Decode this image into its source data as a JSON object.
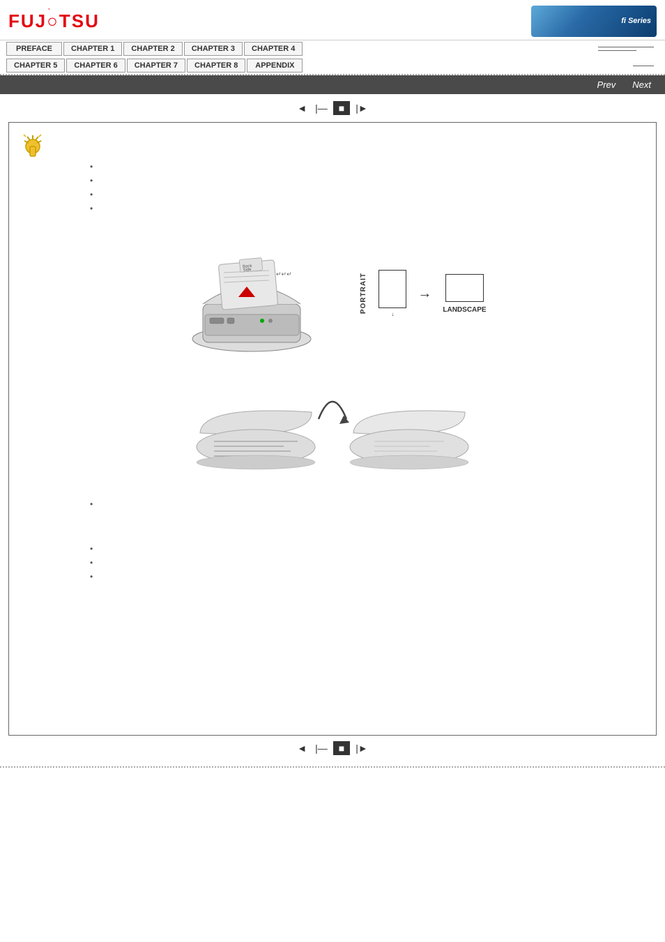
{
  "header": {
    "logo_text": "FUJITSU",
    "banner_text": "fi Series"
  },
  "nav": {
    "row1": [
      {
        "label": "PREFACE",
        "active": false
      },
      {
        "label": "CHAPTER 1",
        "active": false
      },
      {
        "label": "CHAPTER 2",
        "active": false
      },
      {
        "label": "CHAPTER 3",
        "active": false
      },
      {
        "label": "CHAPTER 4",
        "active": false
      }
    ],
    "row2": [
      {
        "label": "CHAPTER 5",
        "active": false
      },
      {
        "label": "CHAPTER 6",
        "active": false
      },
      {
        "label": "CHAPTER 7",
        "active": false
      },
      {
        "label": "CHAPTER 8",
        "active": false
      },
      {
        "label": "APPENDIX",
        "active": false
      }
    ]
  },
  "toolbar": {
    "prev_label": "Prev",
    "next_label": "Next"
  },
  "page_controls": {
    "first_label": "◄",
    "prev_label": "|",
    "current_label": "■",
    "next_label": "►"
  },
  "content": {
    "bullets_top": [
      {
        "text": ""
      },
      {
        "text": ""
      },
      {
        "text": ""
      },
      {
        "text": ""
      }
    ],
    "orientation": {
      "portrait_label": "PORTRAIT",
      "landscape_label": "LANDSCAPE"
    },
    "bullets_bottom": [
      {
        "text": ""
      },
      {
        "text": ""
      },
      {
        "text": ""
      }
    ],
    "extra_bullet": {
      "text": ""
    }
  }
}
